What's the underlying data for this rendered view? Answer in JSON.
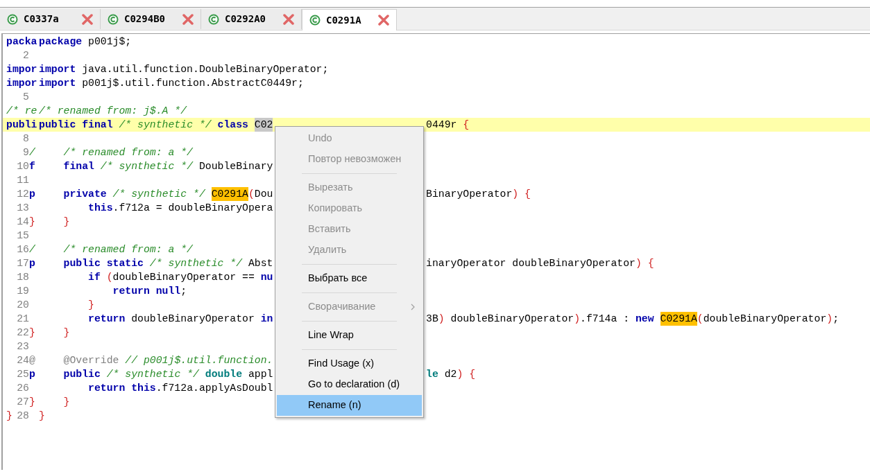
{
  "tabs": [
    {
      "label": "C0337a",
      "selected": false
    },
    {
      "label": "C0294B0",
      "selected": false
    },
    {
      "label": "C0292A0",
      "selected": false
    },
    {
      "label": "C0291A",
      "selected": true
    }
  ],
  "editor": {
    "lines": [
      {
        "current": false,
        "gutter": {
          "lead": {
            "kind": "kw",
            "text": "packa"
          }
        },
        "code": [
          {
            "kind": "kw",
            "text": "package"
          },
          {
            "kind": "plain",
            "text": " p001j$;"
          }
        ]
      },
      {
        "current": false,
        "gutter": {
          "number": "2"
        }
      },
      {
        "current": false,
        "gutter": {
          "lead": {
            "kind": "kw",
            "text": "impor"
          }
        },
        "code": [
          {
            "kind": "kw",
            "text": "import"
          },
          {
            "kind": "plain",
            "text": " java.util.function.DoubleBinaryOperator;"
          }
        ]
      },
      {
        "current": false,
        "gutter": {
          "lead": {
            "kind": "kw",
            "text": "impor"
          }
        },
        "code": [
          {
            "kind": "kw",
            "text": "import"
          },
          {
            "kind": "plain",
            "text": " p001j$.util.function.AbstractC0449r;"
          }
        ]
      },
      {
        "current": false,
        "gutter": {
          "number": "5"
        }
      },
      {
        "current": false,
        "gutter": {
          "lead": {
            "kind": "comment",
            "text": "/* re"
          }
        },
        "code": [
          {
            "kind": "comment",
            "text": "/* renamed from: j$.A */"
          }
        ]
      },
      {
        "current": true,
        "gutter": {
          "lead": {
            "kind": "kw",
            "text": "publi"
          }
        },
        "code": [
          {
            "kind": "kw",
            "text": "public final"
          },
          {
            "kind": "comment",
            "text": " /* synthetic */"
          },
          {
            "kind": "kw",
            "text": " class"
          },
          {
            "kind": "selection",
            "text": " C02"
          }
        ],
        "right": [
          {
            "kind": "plain",
            "text": "0449r"
          },
          {
            "kind": "punct",
            "text": " {"
          }
        ]
      },
      {
        "current": false,
        "gutter": {
          "number": "8"
        }
      },
      {
        "current": false,
        "gutter": {
          "number": "9",
          "mark": {
            "kind": "comment",
            "text": "/"
          }
        },
        "code": [
          {
            "kind": "comment",
            "text": "    /* renamed from: a */"
          }
        ]
      },
      {
        "current": false,
        "gutter": {
          "number": "10",
          "mark": {
            "kind": "kw",
            "text": "f"
          }
        },
        "code": [
          {
            "kind": "kw",
            "text": "    final"
          },
          {
            "kind": "comment",
            "text": " /* synthetic */"
          },
          {
            "kind": "plain",
            "text": " DoubleBinary"
          }
        ]
      },
      {
        "current": false,
        "gutter": {
          "number": "11"
        }
      },
      {
        "current": false,
        "gutter": {
          "number": "12",
          "mark": {
            "kind": "kw",
            "text": "p"
          }
        },
        "code": [
          {
            "kind": "kw",
            "text": "    private"
          },
          {
            "kind": "comment",
            "text": " /* synthetic */"
          },
          {
            "kind": "highlight",
            "text": " C0291A"
          },
          {
            "kind": "punct",
            "text": "("
          },
          {
            "kind": "plain",
            "text": "Dou"
          }
        ],
        "right": [
          {
            "kind": "plain",
            "text": "BinaryOperator"
          },
          {
            "kind": "punct",
            "text": ")"
          },
          {
            "kind": "punct",
            "text": " {"
          }
        ]
      },
      {
        "current": false,
        "gutter": {
          "number": "13"
        },
        "code": [
          {
            "kind": "kw",
            "text": "        this"
          },
          {
            "kind": "plain",
            "text": ".f712a = doubleBinaryOpera"
          }
        ]
      },
      {
        "current": false,
        "gutter": {
          "number": "14",
          "mark": {
            "kind": "punct",
            "text": "}"
          }
        },
        "code": [
          {
            "kind": "punct",
            "text": "    }"
          }
        ]
      },
      {
        "current": false,
        "gutter": {
          "number": "15"
        }
      },
      {
        "current": false,
        "gutter": {
          "number": "16",
          "mark": {
            "kind": "comment",
            "text": "/"
          }
        },
        "code": [
          {
            "kind": "comment",
            "text": "    /* renamed from: a */"
          }
        ]
      },
      {
        "current": false,
        "gutter": {
          "number": "17",
          "mark": {
            "kind": "kw",
            "text": "p"
          }
        },
        "code": [
          {
            "kind": "kw",
            "text": "    public static"
          },
          {
            "kind": "comment",
            "text": " /* synthetic */"
          },
          {
            "kind": "plain",
            "text": " Abst"
          }
        ],
        "right": [
          {
            "kind": "plain",
            "text": "inaryOperator doubleBinaryOperator"
          },
          {
            "kind": "punct",
            "text": ")"
          },
          {
            "kind": "punct",
            "text": " {"
          }
        ]
      },
      {
        "current": false,
        "gutter": {
          "number": "18"
        },
        "code": [
          {
            "kind": "kw",
            "text": "        if"
          },
          {
            "kind": "punct",
            "text": " ("
          },
          {
            "kind": "plain",
            "text": "doubleBinaryOperator =="
          },
          {
            "kind": "kw",
            "text": " nu"
          }
        ]
      },
      {
        "current": false,
        "gutter": {
          "number": "19"
        },
        "code": [
          {
            "kind": "kw",
            "text": "            return null"
          },
          {
            "kind": "plain",
            "text": ";"
          }
        ]
      },
      {
        "current": false,
        "gutter": {
          "number": "20"
        },
        "code": [
          {
            "kind": "punct",
            "text": "        }"
          }
        ]
      },
      {
        "current": false,
        "gutter": {
          "number": "21"
        },
        "code": [
          {
            "kind": "kw",
            "text": "        return"
          },
          {
            "kind": "plain",
            "text": " doubleBinaryOperator"
          },
          {
            "kind": "kw",
            "text": " in"
          }
        ],
        "right": [
          {
            "kind": "plain",
            "text": "3B"
          },
          {
            "kind": "punct",
            "text": ")"
          },
          {
            "kind": "plain",
            "text": " doubleBinaryOperator"
          },
          {
            "kind": "punct",
            "text": ")"
          },
          {
            "kind": "plain",
            "text": ".f714a :"
          },
          {
            "kind": "kw",
            "text": " new"
          },
          {
            "kind": "highlight",
            "text": " C0291A"
          },
          {
            "kind": "punct",
            "text": "("
          },
          {
            "kind": "plain",
            "text": "doubleBinaryOperator"
          },
          {
            "kind": "punct",
            "text": ")"
          },
          {
            "kind": "plain",
            "text": ";"
          }
        ]
      },
      {
        "current": false,
        "gutter": {
          "number": "22",
          "mark": {
            "kind": "punct",
            "text": "}"
          }
        },
        "code": [
          {
            "kind": "punct",
            "text": "    }"
          }
        ]
      },
      {
        "current": false,
        "gutter": {
          "number": "23"
        }
      },
      {
        "current": false,
        "gutter": {
          "number": "24",
          "mark": {
            "kind": "annotation",
            "text": "@"
          }
        },
        "code": [
          {
            "kind": "annotation",
            "text": "    @Override"
          },
          {
            "kind": "comment",
            "text": " // p001j$.util.function."
          }
        ]
      },
      {
        "current": false,
        "gutter": {
          "number": "25",
          "mark": {
            "kind": "kw",
            "text": "p"
          }
        },
        "code": [
          {
            "kind": "kw",
            "text": "    public"
          },
          {
            "kind": "comment",
            "text": " /* synthetic */"
          },
          {
            "kind": "type",
            "text": " double"
          },
          {
            "kind": "plain",
            "text": " appl"
          }
        ],
        "right": [
          {
            "kind": "type",
            "text": "le"
          },
          {
            "kind": "plain",
            "text": " d2"
          },
          {
            "kind": "punct",
            "text": ")"
          },
          {
            "kind": "punct",
            "text": " {"
          }
        ]
      },
      {
        "current": false,
        "gutter": {
          "number": "26"
        },
        "code": [
          {
            "kind": "kw",
            "text": "        return this"
          },
          {
            "kind": "plain",
            "text": ".f712a.applyAsDoubl"
          }
        ]
      },
      {
        "current": false,
        "gutter": {
          "number": "27",
          "mark": {
            "kind": "punct",
            "text": "}"
          }
        },
        "code": [
          {
            "kind": "punct",
            "text": "    }"
          }
        ]
      },
      {
        "current": false,
        "gutter": {
          "lead": {
            "kind": "punct",
            "text": "}"
          },
          "number": "28"
        },
        "code": [
          {
            "kind": "punct",
            "text": "}"
          }
        ]
      }
    ]
  },
  "context_menu": {
    "items": [
      {
        "kind": "item",
        "label": "Undo",
        "disabled": true,
        "selected": false
      },
      {
        "kind": "item",
        "label": "Повтор невозможен",
        "disabled": true,
        "selected": false
      },
      {
        "kind": "separator"
      },
      {
        "kind": "item",
        "label": "Вырезать",
        "disabled": true,
        "selected": false
      },
      {
        "kind": "item",
        "label": "Копировать",
        "disabled": true,
        "selected": false
      },
      {
        "kind": "item",
        "label": "Вставить",
        "disabled": true,
        "selected": false
      },
      {
        "kind": "item",
        "label": "Удалить",
        "disabled": true,
        "selected": false
      },
      {
        "kind": "separator"
      },
      {
        "kind": "item",
        "label": "Выбрать все",
        "disabled": false,
        "selected": false
      },
      {
        "kind": "separator"
      },
      {
        "kind": "submenu",
        "label": "Сворачивание",
        "disabled": true,
        "selected": false
      },
      {
        "kind": "separator"
      },
      {
        "kind": "item",
        "label": "Line Wrap",
        "disabled": false,
        "selected": false
      },
      {
        "kind": "separator"
      },
      {
        "kind": "item",
        "label": "Find Usage (x)",
        "disabled": false,
        "selected": false
      },
      {
        "kind": "item",
        "label": "Go to declaration (d)",
        "disabled": false,
        "selected": false
      },
      {
        "kind": "item",
        "label": "Rename (n)",
        "disabled": false,
        "selected": true
      }
    ]
  }
}
